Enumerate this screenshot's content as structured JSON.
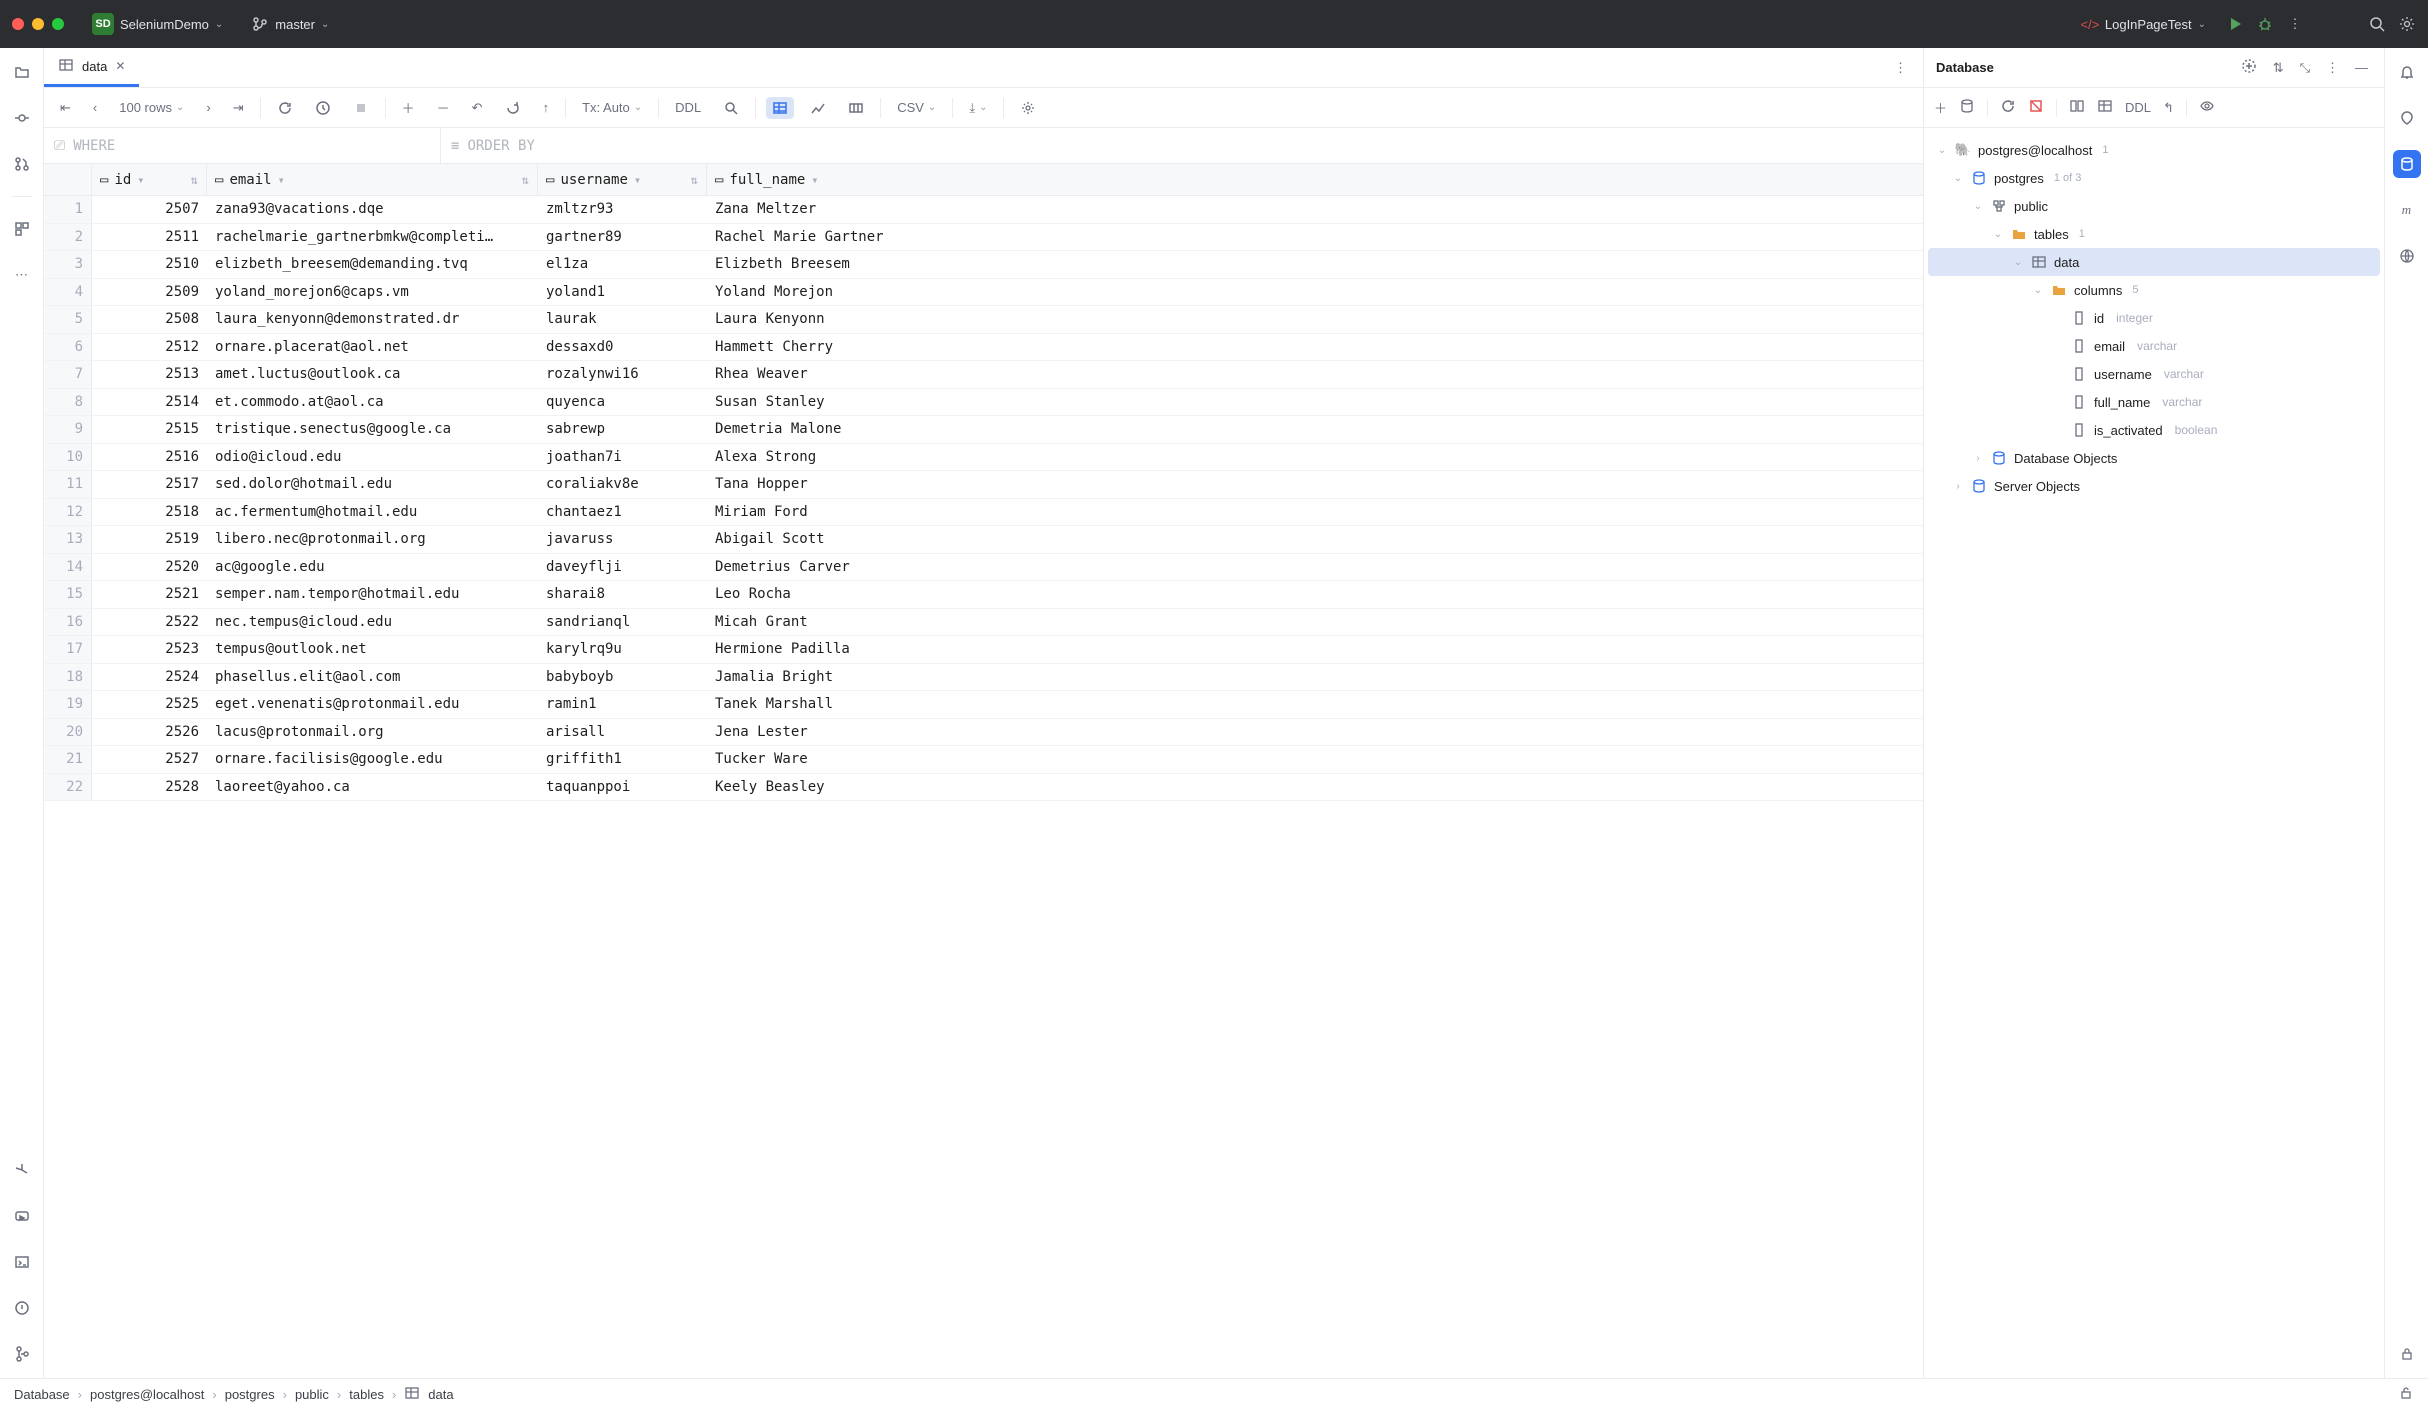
{
  "titlebar": {
    "project_initials": "SD",
    "project_name": "SeleniumDemo",
    "branch": "master",
    "run_config": "LogInPageTest"
  },
  "tab": {
    "label": "data"
  },
  "toolbar": {
    "rows_label": "100 rows",
    "tx_label": "Tx: Auto",
    "ddl_label": "DDL",
    "csv_label": "CSV"
  },
  "filters": {
    "where": "WHERE",
    "order": "ORDER BY"
  },
  "columns": [
    "id",
    "email",
    "username",
    "full_name"
  ],
  "rows": [
    {
      "n": 1,
      "id": 2507,
      "email": "zana93@vacations.dqe",
      "username": "zmltzr93",
      "full_name": "Zana Meltzer"
    },
    {
      "n": 2,
      "id": 2511,
      "email": "rachelmarie_gartnerbmkw@completi…",
      "username": "gartner89",
      "full_name": "Rachel Marie Gartner"
    },
    {
      "n": 3,
      "id": 2510,
      "email": "elizbeth_breesem@demanding.tvq",
      "username": "el1za",
      "full_name": "Elizbeth Breesem"
    },
    {
      "n": 4,
      "id": 2509,
      "email": "yoland_morejon6@caps.vm",
      "username": "yoland1",
      "full_name": "Yoland Morejon"
    },
    {
      "n": 5,
      "id": 2508,
      "email": "laura_kenyonn@demonstrated.dr",
      "username": "laurak",
      "full_name": "Laura Kenyonn"
    },
    {
      "n": 6,
      "id": 2512,
      "email": "ornare.placerat@aol.net",
      "username": "dessaxd0",
      "full_name": "Hammett Cherry"
    },
    {
      "n": 7,
      "id": 2513,
      "email": "amet.luctus@outlook.ca",
      "username": "rozalynwi16",
      "full_name": "Rhea Weaver"
    },
    {
      "n": 8,
      "id": 2514,
      "email": "et.commodo.at@aol.ca",
      "username": "quyenca",
      "full_name": "Susan Stanley"
    },
    {
      "n": 9,
      "id": 2515,
      "email": "tristique.senectus@google.ca",
      "username": "sabrewp",
      "full_name": "Demetria Malone"
    },
    {
      "n": 10,
      "id": 2516,
      "email": "odio@icloud.edu",
      "username": "joathan7i",
      "full_name": "Alexa Strong"
    },
    {
      "n": 11,
      "id": 2517,
      "email": "sed.dolor@hotmail.edu",
      "username": "coraliakv8e",
      "full_name": "Tana Hopper"
    },
    {
      "n": 12,
      "id": 2518,
      "email": "ac.fermentum@hotmail.edu",
      "username": "chantaez1",
      "full_name": "Miriam Ford"
    },
    {
      "n": 13,
      "id": 2519,
      "email": "libero.nec@protonmail.org",
      "username": "javaruss",
      "full_name": "Abigail Scott"
    },
    {
      "n": 14,
      "id": 2520,
      "email": "ac@google.edu",
      "username": "daveyflji",
      "full_name": "Demetrius Carver"
    },
    {
      "n": 15,
      "id": 2521,
      "email": "semper.nam.tempor@hotmail.edu",
      "username": "sharai8",
      "full_name": "Leo Rocha"
    },
    {
      "n": 16,
      "id": 2522,
      "email": "nec.tempus@icloud.edu",
      "username": "sandrianql",
      "full_name": "Micah Grant"
    },
    {
      "n": 17,
      "id": 2523,
      "email": "tempus@outlook.net",
      "username": "karylrq9u",
      "full_name": "Hermione Padilla"
    },
    {
      "n": 18,
      "id": 2524,
      "email": "phasellus.elit@aol.com",
      "username": "babyboyb",
      "full_name": "Jamalia Bright"
    },
    {
      "n": 19,
      "id": 2525,
      "email": "eget.venenatis@protonmail.edu",
      "username": "ramin1",
      "full_name": "Tanek Marshall"
    },
    {
      "n": 20,
      "id": 2526,
      "email": "lacus@protonmail.org",
      "username": "arisall",
      "full_name": "Jena Lester"
    },
    {
      "n": 21,
      "id": 2527,
      "email": "ornare.facilisis@google.edu",
      "username": "griffith1",
      "full_name": "Tucker Ware"
    },
    {
      "n": 22,
      "id": 2528,
      "email": "laoreet@yahoo.ca",
      "username": "taquanppoi",
      "full_name": "Keely Beasley"
    }
  ],
  "database_panel": {
    "title": "Database",
    "ddl_label": "DDL",
    "tree": {
      "datasource": "postgres@localhost",
      "ds_badge": "1",
      "database": "postgres",
      "db_badge": "1 of 3",
      "schema": "public",
      "tables_label": "tables",
      "tables_badge": "1",
      "table": "data",
      "columns_label": "columns",
      "columns_badge": "5",
      "columns": [
        {
          "name": "id",
          "type": "integer"
        },
        {
          "name": "email",
          "type": "varchar"
        },
        {
          "name": "username",
          "type": "varchar"
        },
        {
          "name": "full_name",
          "type": "varchar"
        },
        {
          "name": "is_activated",
          "type": "boolean"
        }
      ],
      "db_objects": "Database Objects",
      "server_objects": "Server Objects"
    }
  },
  "breadcrumbs": [
    "Database",
    "postgres@localhost",
    "postgres",
    "public",
    "tables",
    "data"
  ]
}
